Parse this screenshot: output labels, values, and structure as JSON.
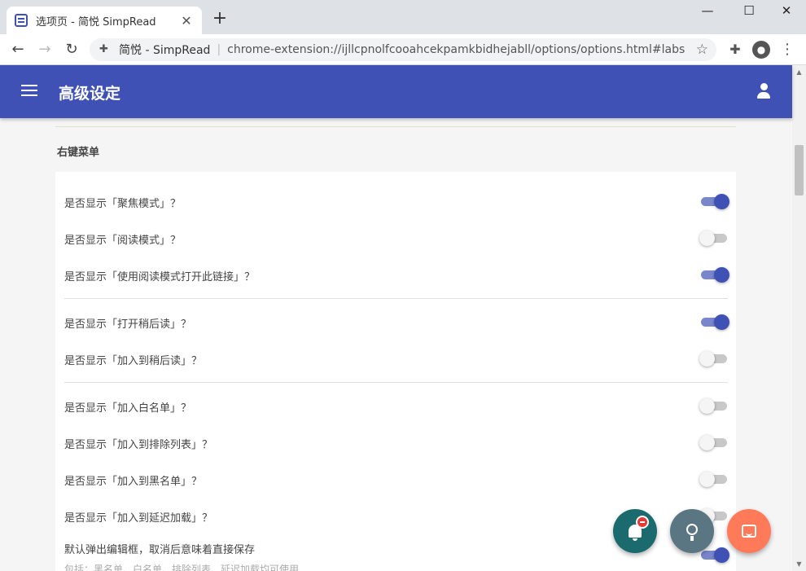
{
  "browser": {
    "tab_title": "选项页 - 简悦 SimpRead",
    "tab_close": "✕",
    "new_tab": "+",
    "win_minimize": "—",
    "win_maximize": "☐",
    "win_close": "✕",
    "back": "←",
    "forward": "→",
    "reload": "↻",
    "site_name": "简悦 - SimpRead",
    "url_separator": "|",
    "url": "chrome-extension://ijllcpnolfcooahcekpamkbidhejabll/options/options.html#labs",
    "bookmark_star": "☆"
  },
  "header": {
    "title": "高级设定"
  },
  "section": {
    "title": "右键菜单"
  },
  "settings": [
    {
      "label": "是否显示「聚焦模式」？",
      "on": true
    },
    {
      "label": "是否显示「阅读模式」？",
      "on": false
    },
    {
      "label": "是否显示「使用阅读模式打开此链接」？",
      "on": true
    },
    {
      "label": "是否显示「打开稍后读」？",
      "on": true
    },
    {
      "label": "是否显示「加入到稍后读」？",
      "on": false
    },
    {
      "label": "是否显示「加入白名单」？",
      "on": false
    },
    {
      "label": "是否显示「加入到排除列表」？",
      "on": false
    },
    {
      "label": "是否显示「加入到黑名单」？",
      "on": false
    },
    {
      "label": "是否显示「加入到延迟加载」？",
      "on": false
    },
    {
      "label": "默认弹出编辑框，取消后意味着直接保存",
      "on": true
    }
  ],
  "settings_sublabel": "包括：黑名单、白名单、排除列表、延迟加载均可使用",
  "colors": {
    "primary": "#3f51b5",
    "toggle_track_on": "#7986cb",
    "fab_notify": "#1b6a6e",
    "fab_idea": "#5a7682",
    "fab_chat": "#ff7a59"
  }
}
